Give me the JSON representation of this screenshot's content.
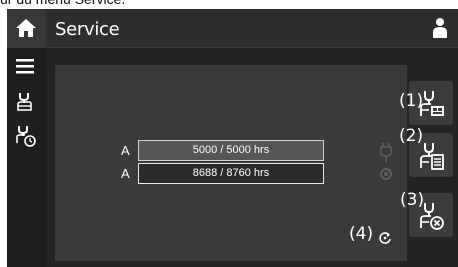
{
  "caption": "ur du menu Service.",
  "header": {
    "title": "Service"
  },
  "rows": [
    {
      "label": "A",
      "value": "5000 / 5000 hrs"
    },
    {
      "label": "A",
      "value": "8688 / 8760 hrs"
    }
  ],
  "callouts": [
    "(1)",
    "(2)",
    "(3)",
    "(4)"
  ],
  "colors": {
    "background": "#232323",
    "topbar": "#2e2e2e",
    "panel": "#3a3a3a",
    "text": "#ffffff"
  },
  "icons": {
    "top_left": "home-icon",
    "top_right": "user-icon",
    "sidebar": [
      "menu-icon",
      "service-wrench-icon",
      "service-timer-icon"
    ],
    "right_buttons": [
      "service-counter-icon",
      "service-checklist-icon",
      "service-reset-icon"
    ],
    "reset": "refresh-icon"
  }
}
